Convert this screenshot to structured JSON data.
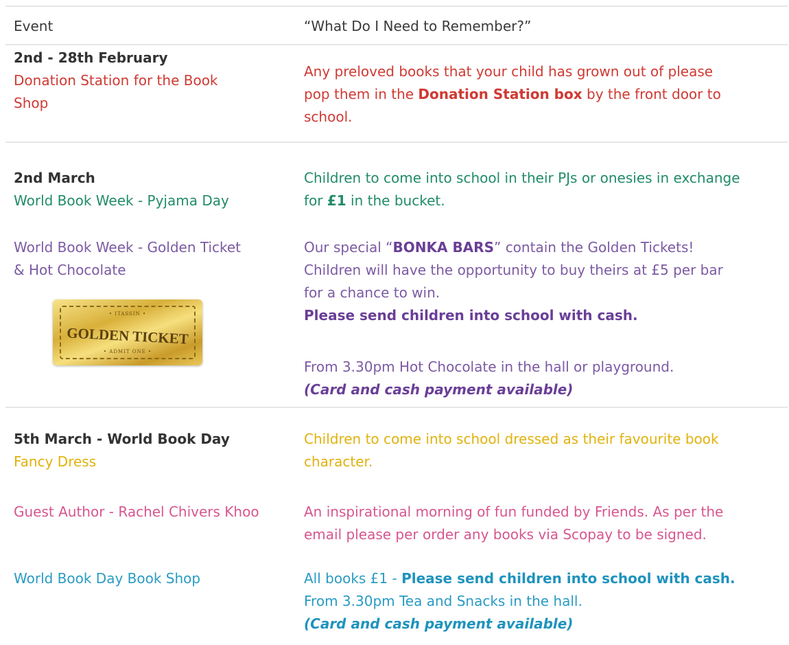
{
  "header": {
    "event": "Event",
    "remember": "“What Do I Need to Remember?”"
  },
  "rows": [
    {
      "date": "2nd - 28th February",
      "event_line1": "Donation Station for the Book",
      "event_line2": "Shop",
      "note_line1": "Any preloved books that your child has grown out of please",
      "note_line2_pre": "pop them in the ",
      "note_line2_bold": "Donation Station box",
      "note_line2_post": " by the front door to",
      "note_line3": "school."
    },
    {
      "date": "2nd March",
      "pyjama_event": "World Book Week - Pyjama Day",
      "pyjama_note_line1": "Children to come into school in their PJs or onesies in exchange",
      "pyjama_note_line2_pre": "for ",
      "pyjama_note_line2_bold": "£1",
      "pyjama_note_line2_post": " in the bucket.",
      "golden_event_line1": "World Book Week - Golden Ticket",
      "golden_event_line2": "& Hot Chocolate",
      "ticket_top": "• ITASSIN •",
      "ticket_title": "GOLDEN TICKET",
      "ticket_bottom": "• ADMIT ONE •",
      "golden_note_line1_pre": "Our special “",
      "golden_note_line1_bold": "BONKA BARS",
      "golden_note_line1_post": "” contain the Golden Tickets!",
      "golden_note_line2": "Children will have the opportunity to buy theirs at £5 per bar",
      "golden_note_line3": "for a chance to win.",
      "golden_note_line4": "Please send children into school with cash.",
      "hot_choc_line1": "From 3.30pm Hot Chocolate in the hall or playground.",
      "hot_choc_line2": "(Card and cash payment available)"
    },
    {
      "date": "5th March - World Book Day",
      "fancy_event": "Fancy Dress",
      "fancy_note_line1": "Children to come into school dressed as their favourite book",
      "fancy_note_line2": "character.",
      "author_event": "Guest Author - Rachel Chivers Khoo",
      "author_note_line1": "An inspirational morning of fun funded by Friends.  As per the",
      "author_note_line2": "email please per order any books via Scopay to be signed.",
      "shop_event": "World Book Day Book Shop",
      "shop_note_line1_pre": "All books £1 - ",
      "shop_note_line1_bold": "Please send children into school with cash.",
      "shop_note_line2": "From 3.30pm Tea and Snacks in the hall.",
      "shop_note_line3": "(Card and cash payment available)"
    }
  ],
  "colors": {
    "red": "#cf3a33",
    "green": "#218b6a",
    "purple": "#7c5aa3",
    "yellow": "#e0b20d",
    "pink": "#d6568f",
    "blue": "#2a9bc4"
  }
}
